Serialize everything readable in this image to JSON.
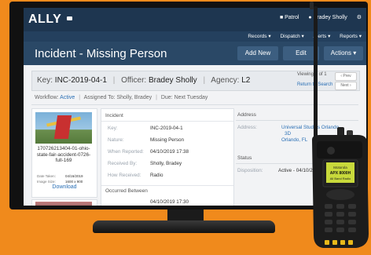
{
  "app": {
    "brand": "ALLY",
    "user": "Bradey Sholly",
    "patrol_label": "Patrol"
  },
  "nav": {
    "records": "Records",
    "dispatch": "Dispatch",
    "alerts": "Alerts",
    "reports": "Reports"
  },
  "header": {
    "title": "Incident - Missing Person",
    "add_new": "Add New",
    "edit": "Edit",
    "actions": "Actions"
  },
  "record": {
    "key_label": "Key:",
    "key_value": "INC-2019-04-1",
    "officer_label": "Officer:",
    "officer_value": "Bradey Sholly",
    "agency_label": "Agency:",
    "agency_value": "L2",
    "viewing": "Viewing 1 of 1",
    "return_link": "Return to Search",
    "prev": "Prev",
    "next": "Next"
  },
  "workflow": {
    "label": "Workflow:",
    "value": "Active",
    "assigned_label": "Assigned To:",
    "assigned_value": "Sholly, Bradey",
    "due_label": "Due:",
    "due_value": "Next Tuesday"
  },
  "attachment": {
    "filename": "170726213404-01-ohio-state-fair-accident-0726-full-169",
    "date_taken_label": "Date Taken:",
    "date_taken_value": "04/16/2019",
    "image_size_label": "Image Size:",
    "image_size_value": "1600 x 900",
    "download": "Download"
  },
  "incident": {
    "section_title": "Incident",
    "fields": [
      {
        "label": "Key:",
        "value": "INC-2019-04-1"
      },
      {
        "label": "Nature:",
        "value": "Missing Person"
      },
      {
        "label": "When Reported:",
        "value": "04/10/2019 17:38"
      },
      {
        "label": "Received By:",
        "value": "Sholly, Bradey"
      },
      {
        "label": "How Received:",
        "value": "Radio"
      }
    ],
    "occurred_title": "Occurred Between",
    "occurred_value": "04/10/2019 17:30"
  },
  "address": {
    "section_title": "Address",
    "address_label": "Address:",
    "address_line1": "Universal Studios Orlando",
    "address_line2": "3D",
    "address_line3": "Orlando, FL",
    "status_title": "Status",
    "disposition_label": "Disposition:",
    "disposition_value": "Active - 04/10/2019"
  },
  "radio_display": {
    "line1": "Motorola",
    "line2": "APX 8000H",
    "line3": "All Band Radio"
  }
}
